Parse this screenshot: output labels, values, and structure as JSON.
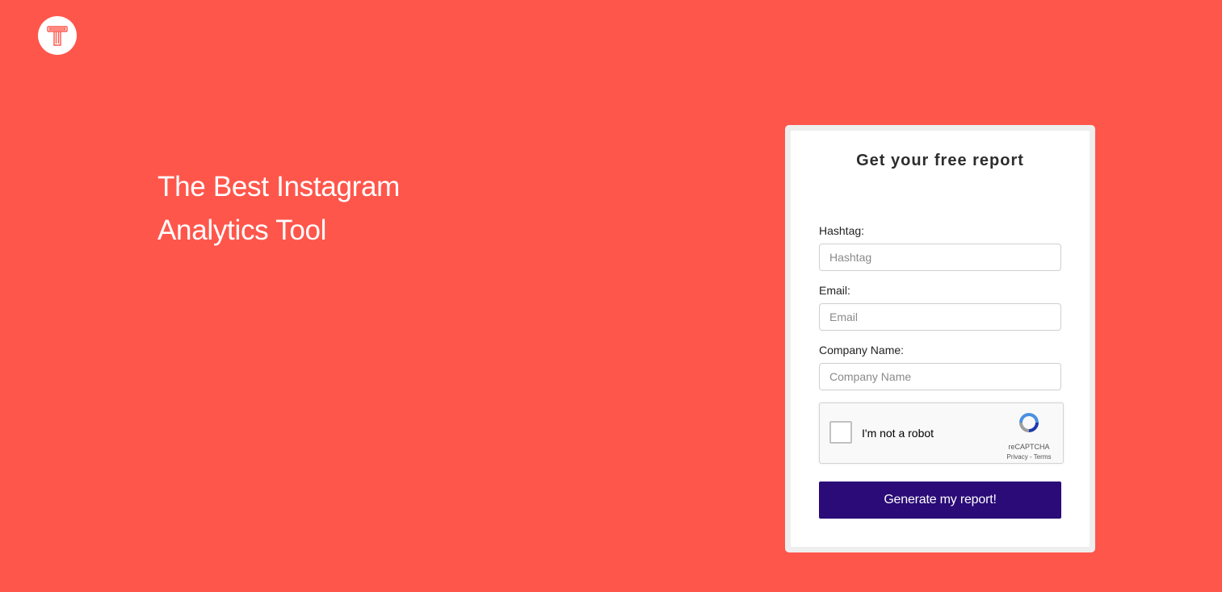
{
  "logo": {
    "icon": "t-logo-icon",
    "accent": "#ff564b"
  },
  "hero": {
    "line1": "The Best Instagram",
    "line2": "Analytics Tool"
  },
  "form": {
    "title": "Get your free report",
    "fields": [
      {
        "label": "Hashtag:",
        "placeholder": "Hashtag",
        "value": ""
      },
      {
        "label": "Email:",
        "placeholder": "Email",
        "value": ""
      },
      {
        "label": "Company Name:",
        "placeholder": "Company Name",
        "value": ""
      }
    ],
    "captcha": {
      "label": "I'm not a robot",
      "brand": "reCAPTCHA",
      "links": "Privacy - Terms",
      "icon": "recaptcha-icon"
    },
    "submit_label": "Generate my report!"
  },
  "colors": {
    "background": "#ff564b",
    "button": "#2a0b77",
    "card": "#ffffff"
  }
}
